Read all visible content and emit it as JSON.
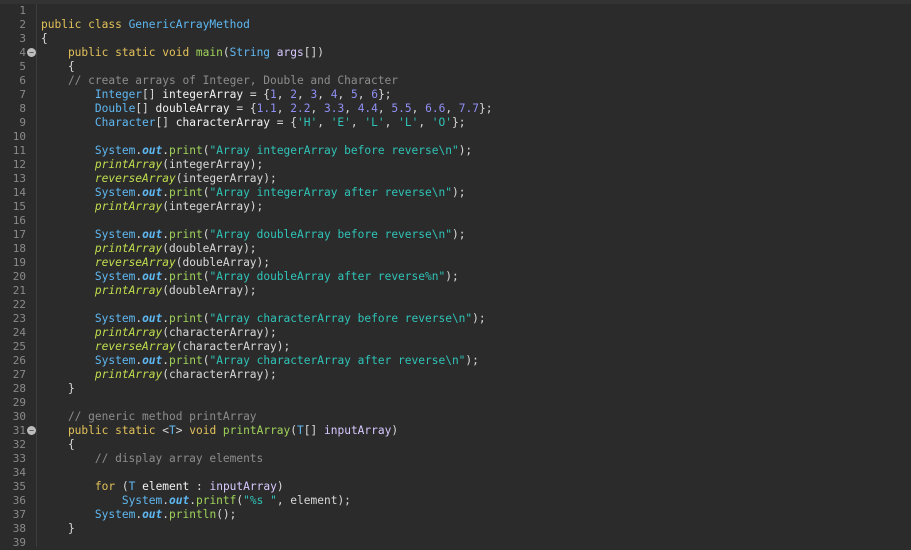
{
  "editor": {
    "colors": {
      "background": "#2b2b2b",
      "keyword": "#e3c15a",
      "class": "#5fb8f2",
      "method": "#9fd35a",
      "string": "#2fc4b8",
      "number": "#8f8ff5",
      "comment": "#8c8c8c",
      "line_number": "#8a8a8a"
    },
    "lines": [
      {
        "n": "1",
        "tokens": []
      },
      {
        "n": "2",
        "tokens": [
          [
            "public class ",
            "kw"
          ],
          [
            "GenericArrayMethod",
            "cls"
          ]
        ]
      },
      {
        "n": "3",
        "tokens": [
          [
            "{",
            "pl"
          ]
        ]
      },
      {
        "n": "4",
        "fold": true,
        "tokens": [
          [
            "    public static void ",
            "kw"
          ],
          [
            "main",
            "mth"
          ],
          [
            "(",
            "pl"
          ],
          [
            "String",
            "cls"
          ],
          [
            " ",
            "pl"
          ],
          [
            "args",
            "par"
          ],
          [
            "[])",
            "pl"
          ]
        ]
      },
      {
        "n": "5",
        "tokens": [
          [
            "    {",
            "pl"
          ]
        ]
      },
      {
        "n": "6",
        "tokens": [
          [
            "    // create arrays of Integer, Double and Character",
            "cmt"
          ]
        ]
      },
      {
        "n": "7",
        "tokens": [
          [
            "        ",
            "pl"
          ],
          [
            "Integer",
            "cls"
          ],
          [
            "[] ",
            "pl"
          ],
          [
            "integerArray",
            "var"
          ],
          [
            " = {",
            "pl"
          ],
          [
            "1",
            "num"
          ],
          [
            ", ",
            "pl"
          ],
          [
            "2",
            "num"
          ],
          [
            ", ",
            "pl"
          ],
          [
            "3",
            "num"
          ],
          [
            ", ",
            "pl"
          ],
          [
            "4",
            "num"
          ],
          [
            ", ",
            "pl"
          ],
          [
            "5",
            "num"
          ],
          [
            ", ",
            "pl"
          ],
          [
            "6",
            "num"
          ],
          [
            "};",
            "pl"
          ]
        ]
      },
      {
        "n": "8",
        "tokens": [
          [
            "        ",
            "pl"
          ],
          [
            "Double",
            "cls"
          ],
          [
            "[] ",
            "pl"
          ],
          [
            "doubleArray",
            "var"
          ],
          [
            " = {",
            "pl"
          ],
          [
            "1.1",
            "num"
          ],
          [
            ", ",
            "pl"
          ],
          [
            "2.2",
            "num"
          ],
          [
            ", ",
            "pl"
          ],
          [
            "3.3",
            "num"
          ],
          [
            ", ",
            "pl"
          ],
          [
            "4.4",
            "num"
          ],
          [
            ", ",
            "pl"
          ],
          [
            "5.5",
            "num"
          ],
          [
            ", ",
            "pl"
          ],
          [
            "6.6",
            "num"
          ],
          [
            ", ",
            "pl"
          ],
          [
            "7.7",
            "num"
          ],
          [
            "};",
            "pl"
          ]
        ]
      },
      {
        "n": "9",
        "tokens": [
          [
            "        ",
            "pl"
          ],
          [
            "Character",
            "cls"
          ],
          [
            "[] ",
            "pl"
          ],
          [
            "characterArray",
            "var"
          ],
          [
            " = {",
            "pl"
          ],
          [
            "'H'",
            "str"
          ],
          [
            ", ",
            "pl"
          ],
          [
            "'E'",
            "str"
          ],
          [
            ", ",
            "pl"
          ],
          [
            "'L'",
            "str"
          ],
          [
            ", ",
            "pl"
          ],
          [
            "'L'",
            "str"
          ],
          [
            ", ",
            "pl"
          ],
          [
            "'O'",
            "str"
          ],
          [
            "};",
            "pl"
          ]
        ]
      },
      {
        "n": "10",
        "tokens": []
      },
      {
        "n": "11",
        "tokens": [
          [
            "        ",
            "pl"
          ],
          [
            "System",
            "cls"
          ],
          [
            ".",
            "pl"
          ],
          [
            "out",
            "sfld"
          ],
          [
            ".",
            "pl"
          ],
          [
            "print",
            "mth"
          ],
          [
            "(",
            "pl"
          ],
          [
            "\"Array integerArray before reverse\\n\"",
            "str"
          ],
          [
            ");",
            "pl"
          ]
        ]
      },
      {
        "n": "12",
        "tokens": [
          [
            "        ",
            "pl"
          ],
          [
            "printArray",
            "smth"
          ],
          [
            "(integerArray);",
            "pl"
          ]
        ]
      },
      {
        "n": "13",
        "tokens": [
          [
            "        ",
            "pl"
          ],
          [
            "reverseArray",
            "smth"
          ],
          [
            "(integerArray);",
            "pl"
          ]
        ]
      },
      {
        "n": "14",
        "tokens": [
          [
            "        ",
            "pl"
          ],
          [
            "System",
            "cls"
          ],
          [
            ".",
            "pl"
          ],
          [
            "out",
            "sfld"
          ],
          [
            ".",
            "pl"
          ],
          [
            "print",
            "mth"
          ],
          [
            "(",
            "pl"
          ],
          [
            "\"Array integerArray after reverse\\n\"",
            "str"
          ],
          [
            ");",
            "pl"
          ]
        ]
      },
      {
        "n": "15",
        "tokens": [
          [
            "        ",
            "pl"
          ],
          [
            "printArray",
            "smth"
          ],
          [
            "(integerArray);",
            "pl"
          ]
        ]
      },
      {
        "n": "16",
        "tokens": []
      },
      {
        "n": "17",
        "tokens": [
          [
            "        ",
            "pl"
          ],
          [
            "System",
            "cls"
          ],
          [
            ".",
            "pl"
          ],
          [
            "out",
            "sfld"
          ],
          [
            ".",
            "pl"
          ],
          [
            "print",
            "mth"
          ],
          [
            "(",
            "pl"
          ],
          [
            "\"Array doubleArray before reverse\\n\"",
            "str"
          ],
          [
            ");",
            "pl"
          ]
        ]
      },
      {
        "n": "18",
        "tokens": [
          [
            "        ",
            "pl"
          ],
          [
            "printArray",
            "smth"
          ],
          [
            "(doubleArray);",
            "pl"
          ]
        ]
      },
      {
        "n": "19",
        "tokens": [
          [
            "        ",
            "pl"
          ],
          [
            "reverseArray",
            "smth"
          ],
          [
            "(doubleArray);",
            "pl"
          ]
        ]
      },
      {
        "n": "20",
        "tokens": [
          [
            "        ",
            "pl"
          ],
          [
            "System",
            "cls"
          ],
          [
            ".",
            "pl"
          ],
          [
            "out",
            "sfld"
          ],
          [
            ".",
            "pl"
          ],
          [
            "print",
            "mth"
          ],
          [
            "(",
            "pl"
          ],
          [
            "\"Array doubleArray after reverse%n\"",
            "str"
          ],
          [
            ");",
            "pl"
          ]
        ]
      },
      {
        "n": "21",
        "tokens": [
          [
            "        ",
            "pl"
          ],
          [
            "printArray",
            "smth"
          ],
          [
            "(doubleArray);",
            "pl"
          ]
        ]
      },
      {
        "n": "22",
        "tokens": []
      },
      {
        "n": "23",
        "tokens": [
          [
            "        ",
            "pl"
          ],
          [
            "System",
            "cls"
          ],
          [
            ".",
            "pl"
          ],
          [
            "out",
            "sfld"
          ],
          [
            ".",
            "pl"
          ],
          [
            "print",
            "mth"
          ],
          [
            "(",
            "pl"
          ],
          [
            "\"Array characterArray before reverse\\n\"",
            "str"
          ],
          [
            ");",
            "pl"
          ]
        ]
      },
      {
        "n": "24",
        "tokens": [
          [
            "        ",
            "pl"
          ],
          [
            "printArray",
            "smth"
          ],
          [
            "(characterArray);",
            "pl"
          ]
        ]
      },
      {
        "n": "25",
        "tokens": [
          [
            "        ",
            "pl"
          ],
          [
            "reverseArray",
            "smth"
          ],
          [
            "(characterArray);",
            "pl"
          ]
        ]
      },
      {
        "n": "26",
        "tokens": [
          [
            "        ",
            "pl"
          ],
          [
            "System",
            "cls"
          ],
          [
            ".",
            "pl"
          ],
          [
            "out",
            "sfld"
          ],
          [
            ".",
            "pl"
          ],
          [
            "print",
            "mth"
          ],
          [
            "(",
            "pl"
          ],
          [
            "\"Array characterArray after reverse\\n\"",
            "str"
          ],
          [
            ");",
            "pl"
          ]
        ]
      },
      {
        "n": "27",
        "tokens": [
          [
            "        ",
            "pl"
          ],
          [
            "printArray",
            "smth"
          ],
          [
            "(characterArray);",
            "pl"
          ]
        ]
      },
      {
        "n": "28",
        "tokens": [
          [
            "    }",
            "pl"
          ]
        ]
      },
      {
        "n": "29",
        "tokens": []
      },
      {
        "n": "30",
        "tokens": [
          [
            "    // generic method printArray",
            "cmt"
          ]
        ]
      },
      {
        "n": "31",
        "fold": true,
        "tokens": [
          [
            "    public static ",
            "kw"
          ],
          [
            "<",
            "pl"
          ],
          [
            "T",
            "cls"
          ],
          [
            "> ",
            "pl"
          ],
          [
            "void ",
            "kw"
          ],
          [
            "printArray",
            "mth"
          ],
          [
            "(",
            "pl"
          ],
          [
            "T",
            "cls"
          ],
          [
            "[] ",
            "pl"
          ],
          [
            "inputArray",
            "par"
          ],
          [
            ")",
            "pl"
          ]
        ]
      },
      {
        "n": "32",
        "tokens": [
          [
            "    {",
            "pl"
          ]
        ]
      },
      {
        "n": "33",
        "tokens": [
          [
            "        // display array elements",
            "cmt"
          ]
        ]
      },
      {
        "n": "34",
        "tokens": []
      },
      {
        "n": "35",
        "tokens": [
          [
            "        ",
            "pl"
          ],
          [
            "for",
            "kw"
          ],
          [
            " (",
            "pl"
          ],
          [
            "T",
            "cls"
          ],
          [
            " ",
            "pl"
          ],
          [
            "element",
            "var"
          ],
          [
            " : ",
            "pl"
          ],
          [
            "inputArray",
            "par"
          ],
          [
            ")",
            "pl"
          ]
        ]
      },
      {
        "n": "36",
        "tokens": [
          [
            "            ",
            "pl"
          ],
          [
            "System",
            "cls"
          ],
          [
            ".",
            "pl"
          ],
          [
            "out",
            "sfld"
          ],
          [
            ".",
            "pl"
          ],
          [
            "printf",
            "mth"
          ],
          [
            "(",
            "pl"
          ],
          [
            "\"%s \"",
            "str"
          ],
          [
            ", element);",
            "pl"
          ]
        ]
      },
      {
        "n": "37",
        "tokens": [
          [
            "        ",
            "pl"
          ],
          [
            "System",
            "cls"
          ],
          [
            ".",
            "pl"
          ],
          [
            "out",
            "sfld"
          ],
          [
            ".",
            "pl"
          ],
          [
            "println",
            "mth"
          ],
          [
            "();",
            "pl"
          ]
        ]
      },
      {
        "n": "38",
        "tokens": [
          [
            "    }",
            "pl"
          ]
        ]
      },
      {
        "n": "39",
        "tokens": []
      }
    ]
  }
}
